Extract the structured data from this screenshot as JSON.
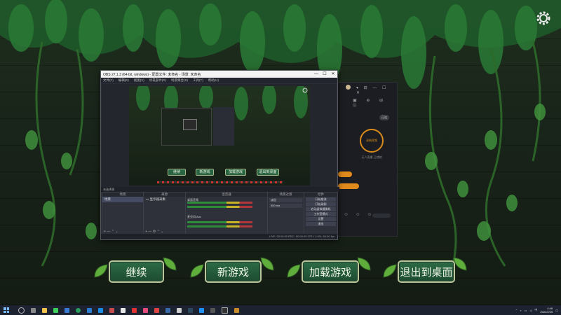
{
  "game": {
    "menu": {
      "continue": "继续",
      "new_game": "新游戏",
      "load_game": "加载游戏",
      "exit_desktop": "退出到桌面"
    },
    "icons": {
      "settings": "gear-icon",
      "leaf": "leaf-icon"
    }
  },
  "obs": {
    "title": "OBS 27.1.3 (64-bit, windows) - 配置文件: 未命名 - 场景: 未命名",
    "window_controls": [
      "—",
      "☐",
      "✕"
    ],
    "menu": [
      "文件(F)",
      "编辑(E)",
      "视图(V)",
      "停靠部件(D)",
      "场景集合(S)",
      "工具(T)",
      "帮助(H)"
    ],
    "preview_buttons": [
      "继续",
      "新游戏",
      "加载游戏",
      "退出到桌面"
    ],
    "source_toolbar": "未选择源",
    "docks": {
      "scenes": {
        "title": "场景",
        "items": [
          "场景"
        ]
      },
      "sources": {
        "title": "来源",
        "items": [
          "显示器采集"
        ]
      },
      "mixer": {
        "title": "混音器",
        "tracks": [
          "桌面音频",
          "麦克风/Aux"
        ]
      },
      "transitions": {
        "title": "场景过渡",
        "type": "淡出",
        "duration": "300 ms"
      },
      "controls": {
        "title": "控件",
        "buttons": [
          "开始推流",
          "开始录制",
          "启动虚拟摄像机",
          "工作室模式",
          "设置",
          "退出"
        ]
      }
    },
    "status_bar": "LIVE: 00:00:00   REC: 00:00:00   CPU: 1.6%, 60.00 fps"
  },
  "side_app": {
    "record_label": "录制视频",
    "sub_label": "无人直播 已就绪",
    "top_pill": "已连"
  },
  "taskbar": {
    "clock_time": "4:46",
    "clock_date": "2022/2/25"
  },
  "colors": {
    "button_green": "#2d6b46",
    "button_border": "#b9c79c",
    "leaf_green": "#5fae3c",
    "obs_bg": "#2b2e38",
    "accent_orange": "#e08a1c"
  }
}
